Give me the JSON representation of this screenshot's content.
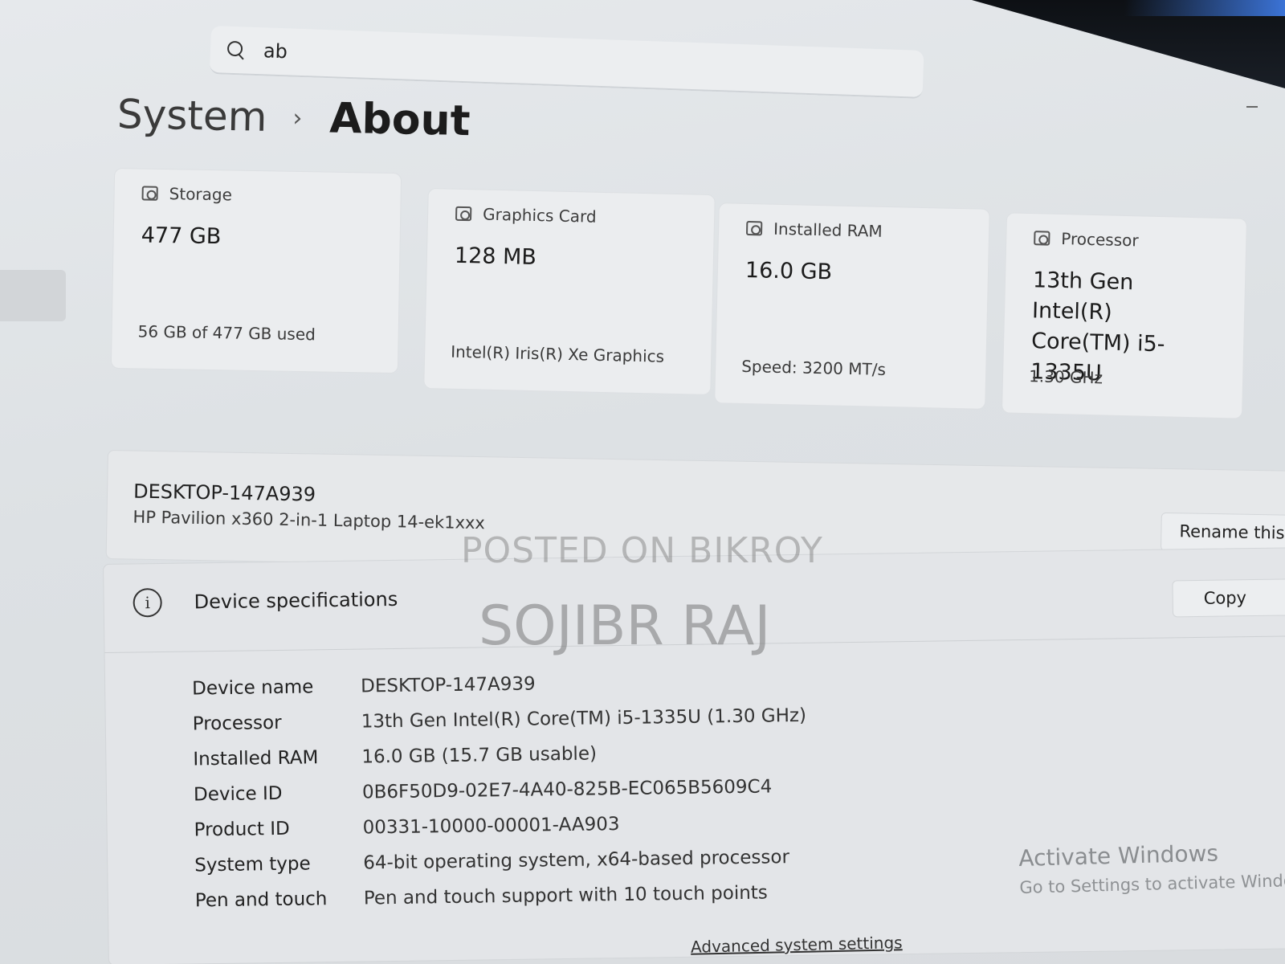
{
  "search": {
    "value": "ab"
  },
  "breadcrumb": {
    "parent": "System",
    "separator": "›",
    "current": "About"
  },
  "cards": [
    {
      "label": "Storage",
      "value": "477 GB",
      "detail": "56 GB of 477 GB used"
    },
    {
      "label": "Graphics Card",
      "value": "128 MB",
      "detail": "Intel(R) Iris(R) Xe Graphics"
    },
    {
      "label": "Installed RAM",
      "value": "16.0 GB",
      "detail": "Speed: 3200 MT/s"
    },
    {
      "label": "Processor",
      "value": "13th Gen Intel(R) Core(TM) i5-1335U",
      "detail": "1.30 GHz"
    }
  ],
  "device": {
    "name": "DESKTOP-147A939",
    "model": "HP Pavilion x360 2-in-1 Laptop 14-ek1xxx",
    "rename_label": "Rename this"
  },
  "specs": {
    "title": "Device specifications",
    "copy_label": "Copy",
    "rows": [
      {
        "label": "Device name",
        "value": "DESKTOP-147A939"
      },
      {
        "label": "Processor",
        "value": "13th Gen Intel(R) Core(TM) i5-1335U (1.30 GHz)"
      },
      {
        "label": "Installed RAM",
        "value": "16.0 GB (15.7 GB usable)"
      },
      {
        "label": "Device ID",
        "value": "0B6F50D9-02E7-4A40-825B-EC065B5609C4"
      },
      {
        "label": "Product ID",
        "value": "00331-10000-00001-AA903"
      },
      {
        "label": "System type",
        "value": "64-bit operating system, x64-based processor"
      },
      {
        "label": "Pen and touch",
        "value": "Pen and touch support with 10 touch points"
      }
    ]
  },
  "activation": {
    "title": "Activate Windows",
    "subtitle": "Go to Settings to activate Windo"
  },
  "advanced_link": "Advanced system settings",
  "watermark": {
    "line1": "POSTED ON BIKROY",
    "line2": "SOJIBR RAJ"
  },
  "icons": {
    "search": "search-icon",
    "storage": "storage-icon",
    "graphics": "graphics-card-icon",
    "ram": "ram-icon",
    "processor": "processor-icon",
    "info": "info-icon"
  }
}
